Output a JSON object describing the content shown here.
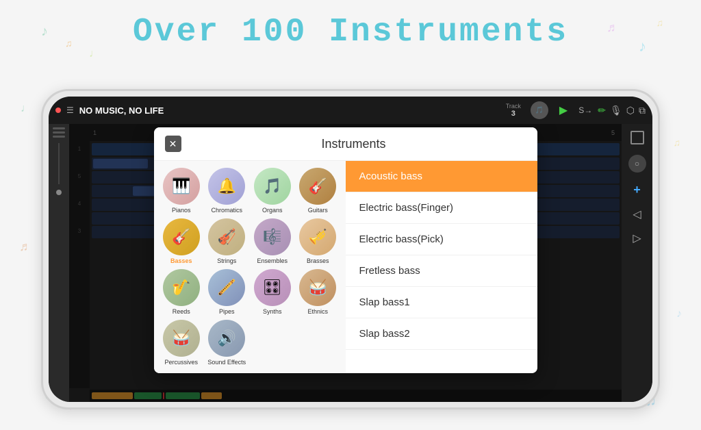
{
  "page": {
    "title": "Over 100 Instruments",
    "bg_color": "#f5f5f5"
  },
  "header": {
    "dot_color": "#ff5555",
    "app_name": "NO MUSIC, NO LIFE",
    "track_label": "Track",
    "track_number": "3",
    "play_icon": "▶",
    "loop_icon": "S→",
    "edit_icon": "✏",
    "mic_icon": "🎤",
    "stamp_icon": "⬡",
    "copy_icon": "⧉"
  },
  "modal": {
    "title": "Instruments",
    "close_label": "✕",
    "instruments": [
      {
        "id": "pianos",
        "label": "Pianos",
        "icon": "🎹",
        "class": "circ-piano",
        "active": false
      },
      {
        "id": "chromatics",
        "label": "Chromatics",
        "icon": "🔔",
        "class": "circ-chromatics",
        "active": false
      },
      {
        "id": "organs",
        "label": "Organs",
        "icon": "🎵",
        "class": "circ-organs",
        "active": false
      },
      {
        "id": "guitars",
        "label": "Guitars",
        "icon": "🎸",
        "class": "circ-guitars",
        "active": false
      },
      {
        "id": "basses",
        "label": "Basses",
        "icon": "🎸",
        "class": "circ-basses",
        "active": true
      },
      {
        "id": "strings",
        "label": "Strings",
        "icon": "🎻",
        "class": "circ-strings",
        "active": false
      },
      {
        "id": "ensembles",
        "label": "Ensembles",
        "icon": "🎼",
        "class": "circ-ensembles",
        "active": false
      },
      {
        "id": "brasses",
        "label": "Brasses",
        "icon": "🎺",
        "class": "circ-brasses",
        "active": false
      },
      {
        "id": "reeds",
        "label": "Reeds",
        "icon": "🎷",
        "class": "circ-reeds",
        "active": false
      },
      {
        "id": "pipes",
        "label": "Pipes",
        "icon": "🪗",
        "class": "circ-pipes",
        "active": false
      },
      {
        "id": "synths",
        "label": "Synths",
        "icon": "🎛",
        "class": "circ-synths",
        "active": false
      },
      {
        "id": "ethnics",
        "label": "Ethnics",
        "icon": "🥁",
        "class": "circ-ethnics",
        "active": false
      },
      {
        "id": "percussives",
        "label": "Percussives",
        "icon": "🥁",
        "class": "circ-percussives",
        "active": false
      },
      {
        "id": "soundfx",
        "label": "Sound Effects",
        "icon": "🔊",
        "class": "circ-soundfx",
        "active": false
      }
    ],
    "list_items": [
      {
        "id": "acoustic-bass",
        "label": "Acoustic bass",
        "active": true
      },
      {
        "id": "electric-bass-finger",
        "label": "Electric bass(Finger)",
        "active": false
      },
      {
        "id": "electric-bass-pick",
        "label": "Electric bass(Pick)",
        "active": false
      },
      {
        "id": "fretless-bass",
        "label": "Fretless bass",
        "active": false
      },
      {
        "id": "slap-bass1",
        "label": "Slap bass1",
        "active": false
      },
      {
        "id": "slap-bass2",
        "label": "Slap bass2",
        "active": false
      }
    ]
  },
  "decorations": {
    "notes": [
      "♩",
      "♪",
      "♫",
      "♬",
      "𝅘𝅥𝅮"
    ],
    "accent_color": "#5bc8d8",
    "note_color": "#a0d8ef"
  }
}
